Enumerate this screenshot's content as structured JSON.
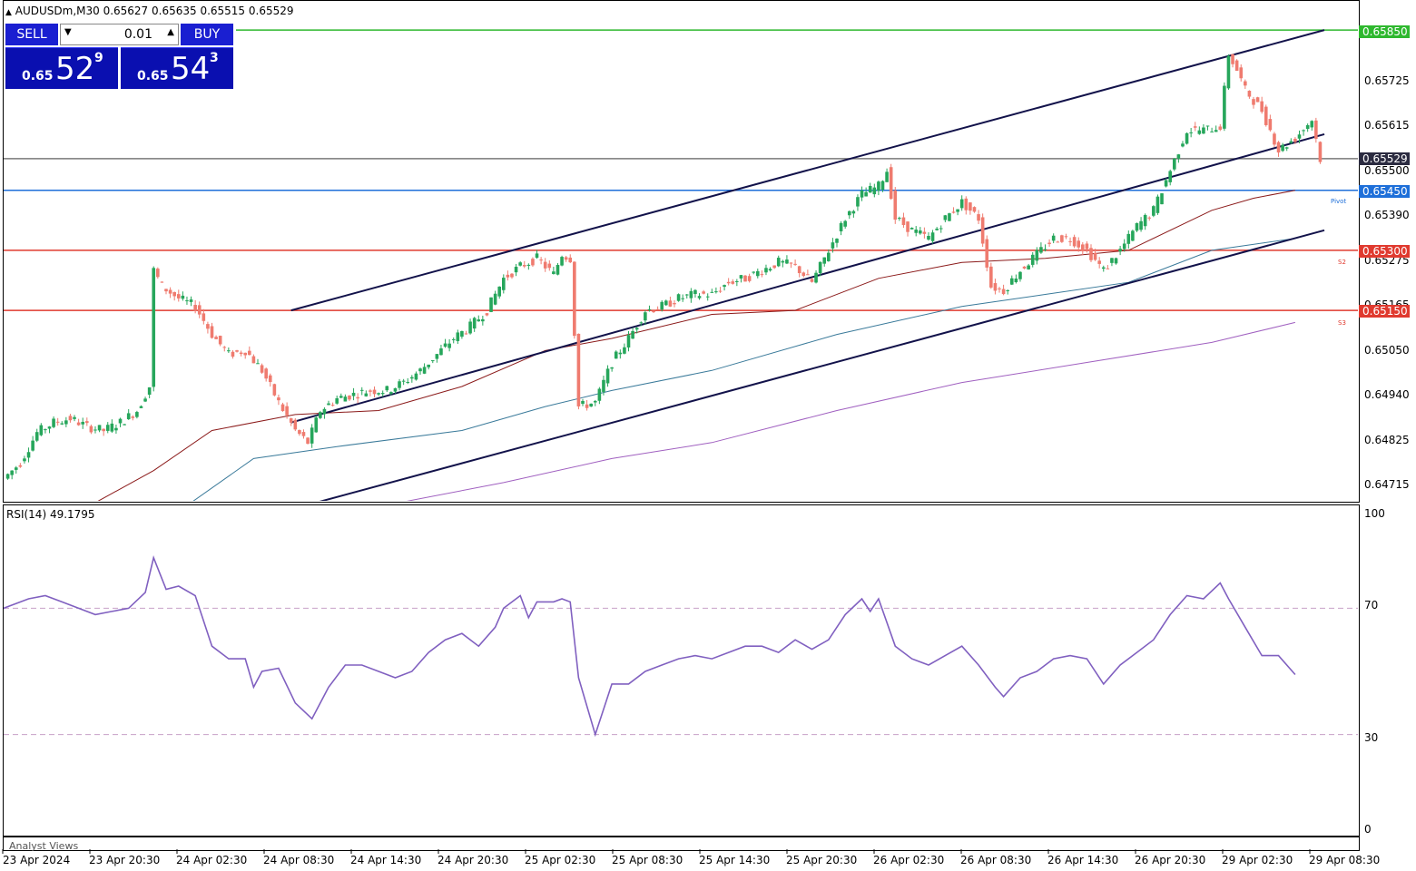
{
  "header": {
    "symbol_line": "AUDUSDm,M30  0.65627 0.65635 0.65515 0.65529",
    "collapse_icon": "triangle-up-icon"
  },
  "trade_panel": {
    "sell_label": "SELL",
    "buy_label": "BUY",
    "volume": "0.01",
    "sell_price": {
      "prefix": "0.65",
      "big": "52",
      "sup": "9"
    },
    "buy_price": {
      "prefix": "0.65",
      "big": "54",
      "sup": "3"
    },
    "colors": {
      "button": "#1a1fd1",
      "panel": "#0a0fb0"
    }
  },
  "price_axis": {
    "ticks": [
      "0.65725",
      "0.65615",
      "0.65500",
      "0.65390",
      "0.65275",
      "0.65165",
      "0.65050",
      "0.64940",
      "0.64825",
      "0.64715"
    ],
    "tags": [
      {
        "label": "0.65850",
        "color": "#2eb82e"
      },
      {
        "label": "0.65529",
        "color": "#2b2b40"
      },
      {
        "label": "0.65450",
        "color": "#1e6fd9"
      },
      {
        "label": "0.65300",
        "color": "#e03a2f"
      },
      {
        "label": "0.65150",
        "color": "#e03a2f"
      }
    ]
  },
  "levels": {
    "pivot_label": "Pivot",
    "s2_label": "S2",
    "s3_label": "S3"
  },
  "rsi": {
    "title": "RSI(14) 49.1795",
    "ticks": [
      "100",
      "70",
      "30",
      "0"
    ],
    "line_color": "#8060c0"
  },
  "time_axis": {
    "labels": [
      "23 Apr 2024",
      "23 Apr 20:30",
      "24 Apr 02:30",
      "24 Apr 08:30",
      "24 Apr 14:30",
      "24 Apr 20:30",
      "25 Apr 02:30",
      "25 Apr 08:30",
      "25 Apr 14:30",
      "25 Apr 20:30",
      "26 Apr 02:30",
      "26 Apr 08:30",
      "26 Apr 14:30",
      "26 Apr 20:30",
      "29 Apr 02:30",
      "29 Apr 08:30"
    ]
  },
  "footer": {
    "label": "Analyst Views"
  },
  "chart_data": [
    {
      "type": "candlestick",
      "symbol": "AUDUSDm",
      "timeframe": "M30",
      "ohlc_last": {
        "open": 0.65627,
        "high": 0.65635,
        "low": 0.65515,
        "close": 0.65529
      },
      "ylim": [
        0.6466,
        0.6588
      ],
      "close_path": [
        [
          0,
          0.6473
        ],
        [
          4,
          0.6477
        ],
        [
          8,
          0.64845
        ],
        [
          12,
          0.6487
        ],
        [
          16,
          0.6488
        ],
        [
          20,
          0.6486
        ],
        [
          24,
          0.6485
        ],
        [
          28,
          0.6487
        ],
        [
          32,
          0.649
        ],
        [
          35,
          0.6496
        ],
        [
          36,
          0.6525
        ],
        [
          38,
          0.6521
        ],
        [
          42,
          0.6518
        ],
        [
          46,
          0.6516
        ],
        [
          50,
          0.6509
        ],
        [
          54,
          0.6504
        ],
        [
          58,
          0.6505
        ],
        [
          62,
          0.65
        ],
        [
          66,
          0.6492
        ],
        [
          70,
          0.6485
        ],
        [
          73,
          0.6482
        ],
        [
          76,
          0.649
        ],
        [
          80,
          0.6493
        ],
        [
          84,
          0.6494
        ],
        [
          88,
          0.6495
        ],
        [
          92,
          0.6495
        ],
        [
          96,
          0.6497
        ],
        [
          100,
          0.65
        ],
        [
          104,
          0.6504
        ],
        [
          108,
          0.6508
        ],
        [
          112,
          0.6511
        ],
        [
          116,
          0.6515
        ],
        [
          120,
          0.6523
        ],
        [
          124,
          0.6526
        ],
        [
          128,
          0.6528
        ],
        [
          132,
          0.6524
        ],
        [
          134,
          0.6529
        ],
        [
          136,
          0.6528
        ],
        [
          138,
          0.6491
        ],
        [
          142,
          0.6492
        ],
        [
          146,
          0.6502
        ],
        [
          150,
          0.6508
        ],
        [
          154,
          0.6515
        ],
        [
          158,
          0.6516
        ],
        [
          162,
          0.6518
        ],
        [
          166,
          0.6519
        ],
        [
          170,
          0.6519
        ],
        [
          174,
          0.6522
        ],
        [
          178,
          0.6523
        ],
        [
          182,
          0.6525
        ],
        [
          186,
          0.6527
        ],
        [
          190,
          0.6526
        ],
        [
          194,
          0.6522
        ],
        [
          198,
          0.653
        ],
        [
          202,
          0.6538
        ],
        [
          206,
          0.6544
        ],
        [
          210,
          0.6546
        ],
        [
          212,
          0.655
        ],
        [
          214,
          0.6538
        ],
        [
          218,
          0.6535
        ],
        [
          222,
          0.6533
        ],
        [
          226,
          0.6538
        ],
        [
          230,
          0.6542
        ],
        [
          234,
          0.6538
        ],
        [
          237,
          0.6521
        ],
        [
          240,
          0.652
        ],
        [
          244,
          0.6525
        ],
        [
          248,
          0.6529
        ],
        [
          252,
          0.6533
        ],
        [
          256,
          0.6533
        ],
        [
          260,
          0.653
        ],
        [
          264,
          0.6525
        ],
        [
          268,
          0.653
        ],
        [
          272,
          0.6536
        ],
        [
          276,
          0.654
        ],
        [
          280,
          0.655
        ],
        [
          284,
          0.656
        ],
        [
          288,
          0.656
        ],
        [
          292,
          0.6561
        ],
        [
          294,
          0.6579
        ],
        [
          296,
          0.6575
        ],
        [
          298,
          0.657
        ],
        [
          302,
          0.6565
        ],
        [
          306,
          0.6555
        ],
        [
          310,
          0.6558
        ],
        [
          314,
          0.65627
        ],
        [
          316,
          0.65529
        ]
      ],
      "channel": [
        {
          "name": "upper",
          "start": [
            0.6515,
            69
          ],
          "end": [
            0.6585,
            317
          ]
        },
        {
          "name": "middle",
          "start": [
            0.6487,
            69
          ],
          "end": [
            0.6559,
            317
          ]
        },
        {
          "name": "lower",
          "start": [
            0.6467,
            75
          ],
          "end": [
            0.6535,
            317
          ]
        }
      ],
      "moving_averages": [
        {
          "color": "#8b1a1a",
          "values": [
            [
              22,
              0.6467
            ],
            [
              36,
              0.6475
            ],
            [
              50,
              0.6485
            ],
            [
              70,
              0.6489
            ],
            [
              90,
              0.649
            ],
            [
              110,
              0.6496
            ],
            [
              130,
              0.6505
            ],
            [
              146,
              0.6508
            ],
            [
              170,
              0.6514
            ],
            [
              190,
              0.6515
            ],
            [
              210,
              0.6523
            ],
            [
              230,
              0.6527
            ],
            [
              250,
              0.6528
            ],
            [
              270,
              0.653
            ],
            [
              290,
              0.654
            ],
            [
              300,
              0.6543
            ],
            [
              310,
              0.6545
            ]
          ]
        },
        {
          "color": "#3a7a9a",
          "values": [
            [
              45,
              0.6467
            ],
            [
              60,
              0.6478
            ],
            [
              80,
              0.6481
            ],
            [
              110,
              0.6485
            ],
            [
              130,
              0.6491
            ],
            [
              146,
              0.6495
            ],
            [
              170,
              0.65
            ],
            [
              200,
              0.6509
            ],
            [
              230,
              0.6516
            ],
            [
              250,
              0.6519
            ],
            [
              270,
              0.6522
            ],
            [
              290,
              0.653
            ],
            [
              310,
              0.6533
            ]
          ]
        },
        {
          "color": "#a060c0",
          "values": [
            [
              95,
              0.6467
            ],
            [
              120,
              0.6472
            ],
            [
              146,
              0.6478
            ],
            [
              170,
              0.6482
            ],
            [
              200,
              0.649
            ],
            [
              230,
              0.6497
            ],
            [
              260,
              0.6502
            ],
            [
              290,
              0.6507
            ],
            [
              310,
              0.6512
            ]
          ]
        }
      ],
      "horizontal_levels": [
        {
          "label": "0.65850",
          "value": 0.6585,
          "color": "#2eb82e"
        },
        {
          "label": "0.65529",
          "value": 0.65529,
          "color": "#7a7a7a"
        },
        {
          "label": "0.65450",
          "value": 0.6545,
          "color": "#1e6fd9"
        },
        {
          "label": "0.65300",
          "value": 0.653,
          "color": "#e03a2f"
        },
        {
          "label": "0.65150",
          "value": 0.6515,
          "color": "#e03a2f"
        }
      ]
    },
    {
      "type": "line",
      "title": "RSI(14) 49.1795",
      "ylim": [
        0,
        100
      ],
      "reference_levels": [
        70,
        30
      ],
      "values": [
        [
          0,
          70
        ],
        [
          6,
          73
        ],
        [
          10,
          74
        ],
        [
          14,
          72
        ],
        [
          18,
          70
        ],
        [
          22,
          68
        ],
        [
          26,
          69
        ],
        [
          30,
          70
        ],
        [
          34,
          75
        ],
        [
          36,
          86
        ],
        [
          39,
          76
        ],
        [
          42,
          77
        ],
        [
          46,
          74
        ],
        [
          50,
          58
        ],
        [
          54,
          54
        ],
        [
          58,
          54
        ],
        [
          60,
          45
        ],
        [
          62,
          50
        ],
        [
          66,
          51
        ],
        [
          70,
          40
        ],
        [
          74,
          35
        ],
        [
          78,
          45
        ],
        [
          82,
          52
        ],
        [
          86,
          52
        ],
        [
          90,
          50
        ],
        [
          94,
          48
        ],
        [
          98,
          50
        ],
        [
          102,
          56
        ],
        [
          106,
          60
        ],
        [
          110,
          62
        ],
        [
          114,
          58
        ],
        [
          118,
          64
        ],
        [
          120,
          70
        ],
        [
          124,
          74
        ],
        [
          126,
          67
        ],
        [
          128,
          72
        ],
        [
          132,
          72
        ],
        [
          134,
          73
        ],
        [
          136,
          72
        ],
        [
          138,
          48
        ],
        [
          142,
          30
        ],
        [
          146,
          46
        ],
        [
          150,
          46
        ],
        [
          154,
          50
        ],
        [
          158,
          52
        ],
        [
          162,
          54
        ],
        [
          166,
          55
        ],
        [
          170,
          54
        ],
        [
          174,
          56
        ],
        [
          178,
          58
        ],
        [
          182,
          58
        ],
        [
          186,
          56
        ],
        [
          190,
          60
        ],
        [
          194,
          57
        ],
        [
          198,
          60
        ],
        [
          202,
          68
        ],
        [
          206,
          73
        ],
        [
          208,
          69
        ],
        [
          210,
          73
        ],
        [
          214,
          58
        ],
        [
          218,
          54
        ],
        [
          222,
          52
        ],
        [
          226,
          55
        ],
        [
          230,
          58
        ],
        [
          234,
          52
        ],
        [
          238,
          45
        ],
        [
          240,
          42
        ],
        [
          244,
          48
        ],
        [
          248,
          50
        ],
        [
          252,
          54
        ],
        [
          256,
          55
        ],
        [
          260,
          54
        ],
        [
          264,
          46
        ],
        [
          268,
          52
        ],
        [
          272,
          56
        ],
        [
          276,
          60
        ],
        [
          280,
          68
        ],
        [
          284,
          74
        ],
        [
          288,
          73
        ],
        [
          292,
          78
        ],
        [
          294,
          73
        ],
        [
          298,
          64
        ],
        [
          302,
          55
        ],
        [
          306,
          55
        ],
        [
          310,
          49
        ]
      ]
    }
  ]
}
